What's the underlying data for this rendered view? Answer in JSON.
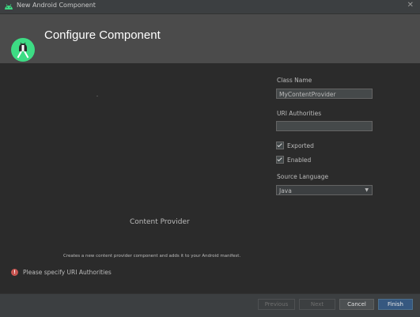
{
  "window": {
    "title": "New Android Component",
    "close_glyph": "✕"
  },
  "header": {
    "title": "Configure Component"
  },
  "form": {
    "class_name_label": "Class Name",
    "class_name_value": "MyContentProvider",
    "uri_label": "URI Authorities",
    "uri_value": "",
    "exported_label": "Exported",
    "exported_checked": true,
    "enabled_label": "Enabled",
    "enabled_checked": true,
    "source_language_label": "Source Language",
    "source_language_value": "Java"
  },
  "preview": {
    "title": "Content Provider",
    "description": "Creates a new content provider component and adds it to your Android manifest."
  },
  "validation": {
    "icon": "!",
    "message": "Please specify URI Authorities"
  },
  "buttons": {
    "previous": "Previous",
    "next": "Next",
    "cancel": "Cancel",
    "finish": "Finish"
  },
  "colors": {
    "android_green": "#3ddc84",
    "header_bg": "#4b4b4b",
    "error_red": "#c75450",
    "default_button": "#365880"
  }
}
